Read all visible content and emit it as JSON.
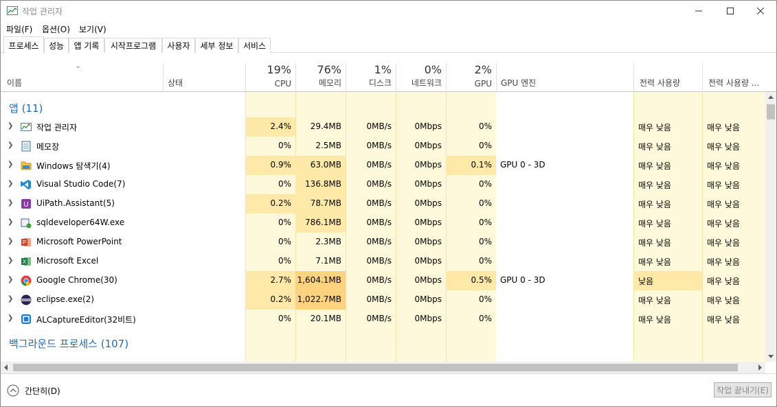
{
  "window": {
    "title": "작업 관리자",
    "controls": [
      "minimize",
      "maximize",
      "close"
    ]
  },
  "menu": [
    "파일(F)",
    "옵션(O)",
    "보기(V)"
  ],
  "tabs": [
    "프로세스",
    "성능",
    "앱 기록",
    "시작프로그램",
    "사용자",
    "세부 정보",
    "서비스"
  ],
  "columns": {
    "name": "이름",
    "status": "상태",
    "cpu": {
      "pct": "19%",
      "label": "CPU"
    },
    "memory": {
      "pct": "76%",
      "label": "메모리"
    },
    "disk": {
      "pct": "1%",
      "label": "디스크"
    },
    "network": {
      "pct": "0%",
      "label": "네트워크"
    },
    "gpu": {
      "pct": "2%",
      "label": "GPU"
    },
    "gpu_engine": "GPU 엔진",
    "power": "전력 사용량",
    "power_trend": "전력 사용량 ..."
  },
  "groups": {
    "apps": "앱 (11)",
    "background": "백그라운드 프로세스 (107)"
  },
  "apps": [
    {
      "name": "작업 관리자",
      "icon": "task-manager-icon",
      "cpu": "2.4%",
      "mem": "29.4MB",
      "disk": "0MB/s",
      "net": "0Mbps",
      "gpu": "0%",
      "engine": "",
      "power": "매우 낮음",
      "trend": "매우 낮음"
    },
    {
      "name": "메모장",
      "icon": "notepad-icon",
      "cpu": "0%",
      "mem": "2.5MB",
      "disk": "0MB/s",
      "net": "0Mbps",
      "gpu": "0%",
      "engine": "",
      "power": "매우 낮음",
      "trend": "매우 낮음"
    },
    {
      "name": "Windows 탐색기(4)",
      "icon": "folder-icon",
      "cpu": "0.9%",
      "mem": "63.0MB",
      "disk": "0MB/s",
      "net": "0Mbps",
      "gpu": "0.1%",
      "engine": "GPU 0 - 3D",
      "power": "매우 낮음",
      "trend": "매우 낮음"
    },
    {
      "name": "Visual Studio Code(7)",
      "icon": "vscode-icon",
      "cpu": "0%",
      "mem": "136.8MB",
      "disk": "0MB/s",
      "net": "0Mbps",
      "gpu": "0%",
      "engine": "",
      "power": "매우 낮음",
      "trend": "매우 낮음"
    },
    {
      "name": "UiPath.Assistant(5)",
      "icon": "uipath-icon",
      "cpu": "0.2%",
      "mem": "78.7MB",
      "disk": "0MB/s",
      "net": "0Mbps",
      "gpu": "0%",
      "engine": "",
      "power": "매우 낮음",
      "trend": "매우 낮음"
    },
    {
      "name": "sqldeveloper64W.exe",
      "icon": "sqldeveloper-icon",
      "cpu": "0%",
      "mem": "786.1MB",
      "disk": "0MB/s",
      "net": "0Mbps",
      "gpu": "0%",
      "engine": "",
      "power": "매우 낮음",
      "trend": "매우 낮음"
    },
    {
      "name": "Microsoft PowerPoint",
      "icon": "powerpoint-icon",
      "cpu": "0%",
      "mem": "2.3MB",
      "disk": "0MB/s",
      "net": "0Mbps",
      "gpu": "0%",
      "engine": "",
      "power": "매우 낮음",
      "trend": "매우 낮음"
    },
    {
      "name": "Microsoft Excel",
      "icon": "excel-icon",
      "cpu": "0%",
      "mem": "7.1MB",
      "disk": "0MB/s",
      "net": "0Mbps",
      "gpu": "0%",
      "engine": "",
      "power": "매우 낮음",
      "trend": "매우 낮음"
    },
    {
      "name": "Google Chrome(30)",
      "icon": "chrome-icon",
      "cpu": "2.7%",
      "mem": "1,604.1MB",
      "disk": "0MB/s",
      "net": "0Mbps",
      "gpu": "0.5%",
      "engine": "GPU 0 - 3D",
      "power": "낮음",
      "trend": "매우 낮음"
    },
    {
      "name": "eclipse.exe(2)",
      "icon": "eclipse-icon",
      "cpu": "0.2%",
      "mem": "1,022.7MB",
      "disk": "0MB/s",
      "net": "0Mbps",
      "gpu": "0%",
      "engine": "",
      "power": "매우 낮음",
      "trend": "매우 낮음"
    },
    {
      "name": "ALCaptureEditor(32비트)",
      "icon": "alcapture-icon",
      "cpu": "0%",
      "mem": "20.1MB",
      "disk": "0MB/s",
      "net": "0Mbps",
      "gpu": "0%",
      "engine": "",
      "power": "매우 낮음",
      "trend": "매우 낮음"
    }
  ],
  "footer": {
    "fewer_details": "간단히(D)",
    "end_task": "작업 끝내기(E)"
  }
}
